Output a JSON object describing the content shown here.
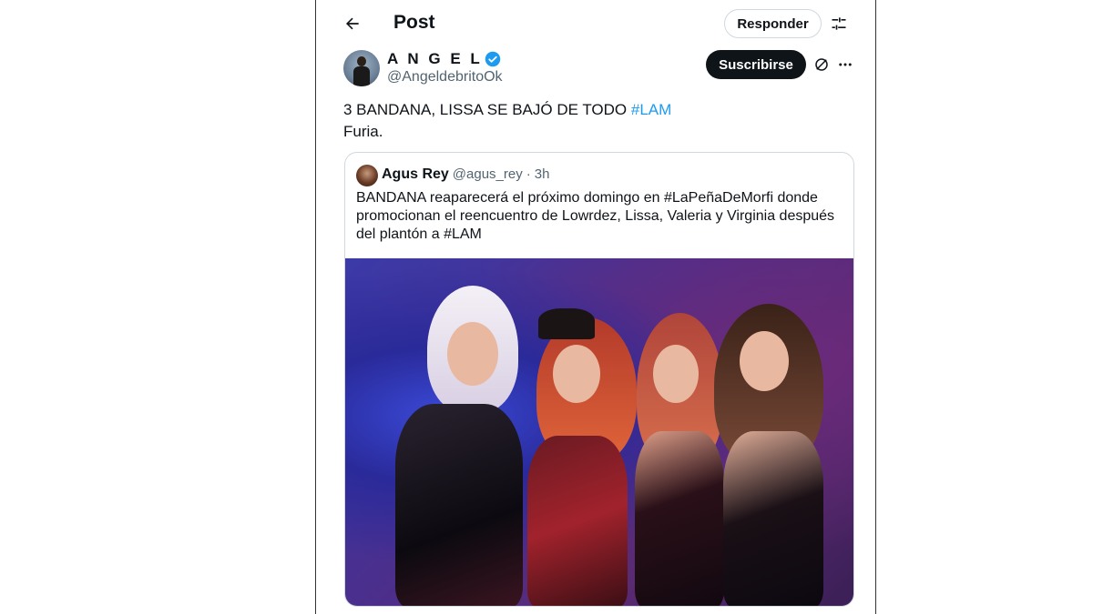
{
  "header": {
    "title": "Post",
    "reply_label": "Responder"
  },
  "post": {
    "author_name": "A N G E L",
    "author_handle": "@AngeldebritoOk",
    "subscribe_label": "Suscribirse",
    "text_line1": "3 BANDANA, LISSA SE BAJÓ DE TODO ",
    "hashtag": "#LAM",
    "text_line2": "Furia."
  },
  "quote": {
    "name": "Agus Rey",
    "handle": "@agus_rey",
    "separator": "·",
    "time": "3h",
    "text": "BANDANA reaparecerá el próximo domingo en #LaPeñaDeMorfi donde promocionan el reencuentro de Lowrdez, Lissa, Valeria y Virginia después del plantón a #LAM"
  },
  "colors": {
    "accent": "#1d9bf0",
    "text": "#0f1419",
    "muted": "#536471",
    "border": "#cfd9de"
  },
  "icons": {
    "back": "arrow-left-icon",
    "filter": "sliders-icon",
    "verified": "verified-badge-icon",
    "grok": "grok-icon",
    "more": "more-horizontal-icon"
  }
}
